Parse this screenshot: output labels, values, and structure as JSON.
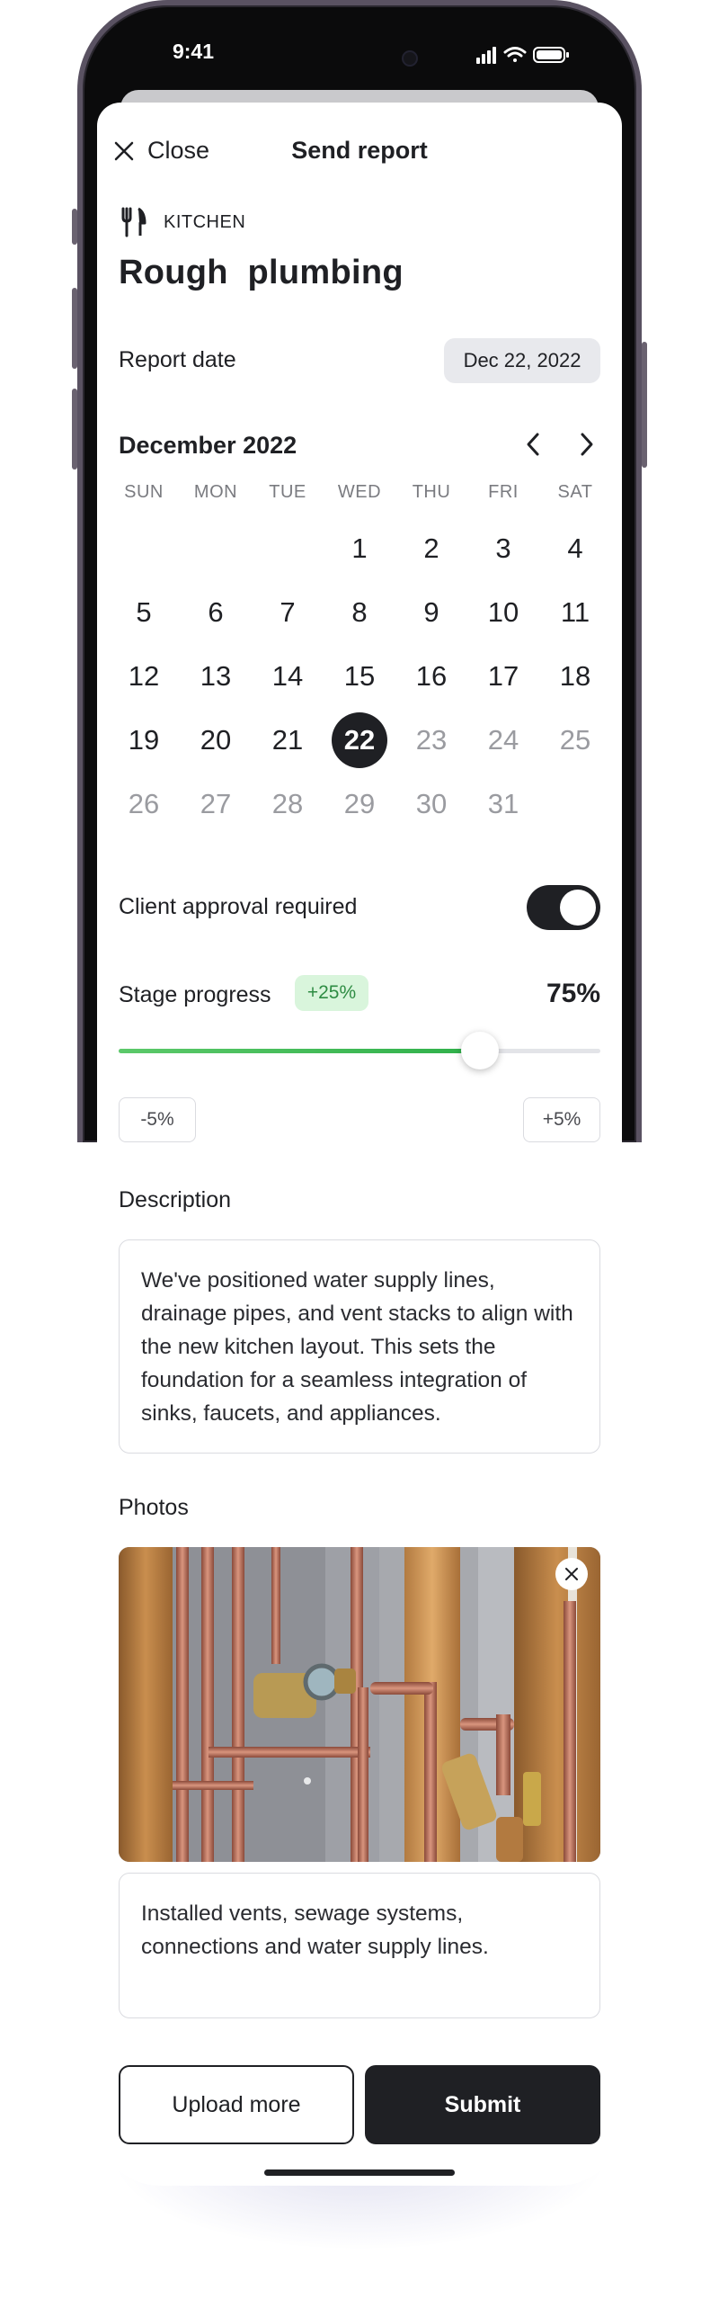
{
  "status_bar": {
    "time": "9:41"
  },
  "nav": {
    "close_label": "Close",
    "title": "Send report"
  },
  "category": {
    "icon": "fork-knife-icon",
    "label": "KITCHEN"
  },
  "page_title": "Rough  plumbing",
  "report_date": {
    "label": "Report date",
    "value": "Dec 22, 2022"
  },
  "calendar": {
    "month_label": "December 2022",
    "weekdays": [
      "SUN",
      "MON",
      "TUE",
      "WED",
      "THU",
      "FRI",
      "SAT"
    ],
    "leading_blanks": 3,
    "days": [
      "1",
      "2",
      "3",
      "4",
      "5",
      "6",
      "7",
      "8",
      "9",
      "10",
      "11",
      "12",
      "13",
      "14",
      "15",
      "16",
      "17",
      "18",
      "19",
      "20",
      "21",
      "22",
      "23",
      "24",
      "25",
      "26",
      "27",
      "28",
      "29",
      "30",
      "31"
    ],
    "selected_day": "22",
    "muted_after_selected": true
  },
  "approval": {
    "label": "Client approval required",
    "enabled": true
  },
  "progress": {
    "label": "Stage progress",
    "badge": "+25%",
    "value_label": "75%",
    "value": 0.75,
    "decrement_label": "-5%",
    "increment_label": "+5%"
  },
  "description": {
    "label": "Description",
    "text": "We've positioned water supply lines, drainage pipes, and vent stacks to align with the new kitchen layout. This sets the foundation for a seamless integration of sinks, faucets, and appliances."
  },
  "photos": {
    "label": "Photos",
    "caption": "Installed vents, sewage systems, connections and water supply lines."
  },
  "actions": {
    "upload_label": "Upload more",
    "submit_label": "Submit"
  },
  "colors": {
    "accent": "#1f2024",
    "progress_green": "#2fb04a",
    "badge_bg": "#d9f5dc",
    "badge_text": "#2e8c43",
    "chip_bg": "#e8e9ed"
  }
}
